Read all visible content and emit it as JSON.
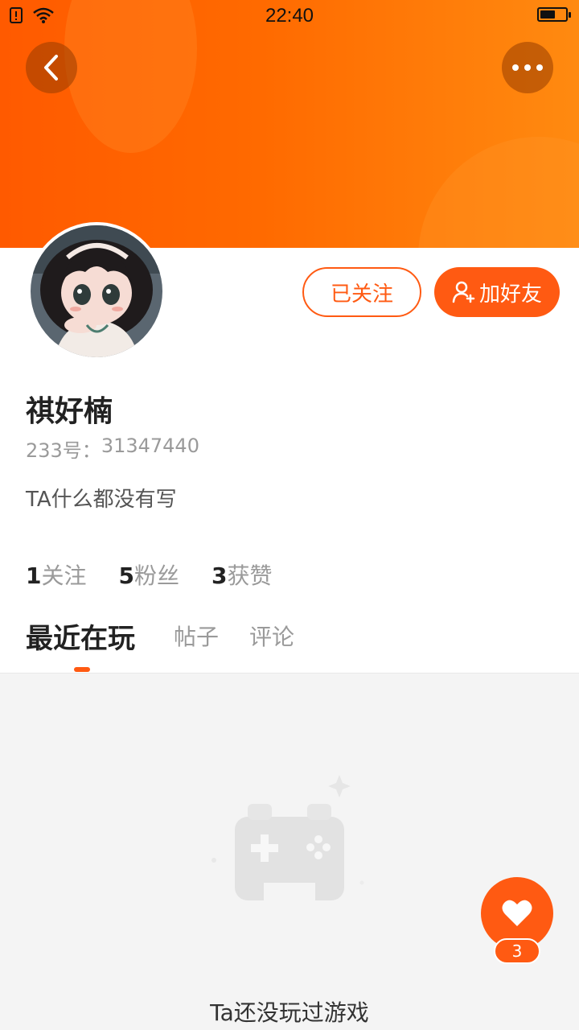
{
  "status_bar": {
    "time": "22:40",
    "battery_level": 0.6,
    "icons": [
      "sim-alert-icon",
      "wifi-icon",
      "battery-icon"
    ]
  },
  "header": {
    "back_icon": "chevron-left-icon",
    "more_icon": "more-dots-icon",
    "accent_color": "#ff5a12"
  },
  "profile": {
    "name": "祺好楠",
    "id_label": "233号：",
    "id_value": "31347440",
    "bio": "TA什么都没有写",
    "follow_button": "已关注",
    "add_friend_button": "加好友",
    "stats": [
      {
        "num": "1",
        "label": "关注"
      },
      {
        "num": "5",
        "label": "粉丝"
      },
      {
        "num": "3",
        "label": "获赞"
      }
    ]
  },
  "tabs": [
    {
      "label": "最近在玩",
      "active": true
    },
    {
      "label": "帖子",
      "active": false
    },
    {
      "label": "评论",
      "active": false
    }
  ],
  "empty_state": {
    "text": "Ta还没玩过游戏",
    "icon": "gamepad-icon"
  },
  "like_fab": {
    "icon": "heart-icon",
    "count": "3"
  }
}
